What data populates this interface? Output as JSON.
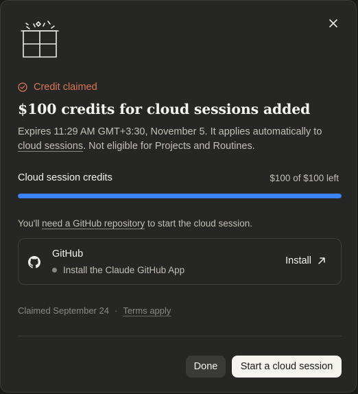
{
  "dialog": {
    "status_text": "Credit claimed",
    "title": "$100 credits for cloud sessions added",
    "description": {
      "part1": "Expires 11:29 AM GMT+3:30, November 5. It applies automatically to ",
      "link": "cloud sessions",
      "part2": ". Not eligible for Projects and Routines."
    },
    "credits": {
      "label": "Cloud session credits",
      "amount_text": "$100 of $100 left",
      "fraction_remaining": 1.0
    },
    "hint": {
      "prefix": "You'll ",
      "link": "need a GitHub repository",
      "suffix": " to start the cloud session."
    },
    "github_card": {
      "name": "GitHub",
      "subtitle": "Install the Claude GitHub App",
      "install_label": "Install"
    },
    "footer": {
      "claimed_text": "Claimed September 24",
      "separator": "·",
      "terms_link": "Terms apply"
    },
    "buttons": {
      "done": "Done",
      "start": "Start a cloud session"
    }
  },
  "colors": {
    "accent": "#d97757",
    "progress": "#3b82f6",
    "background": "#262624"
  },
  "icons": [
    "gift-icon",
    "check-circle-icon",
    "close-icon",
    "github-icon",
    "arrow-up-right-icon"
  ]
}
